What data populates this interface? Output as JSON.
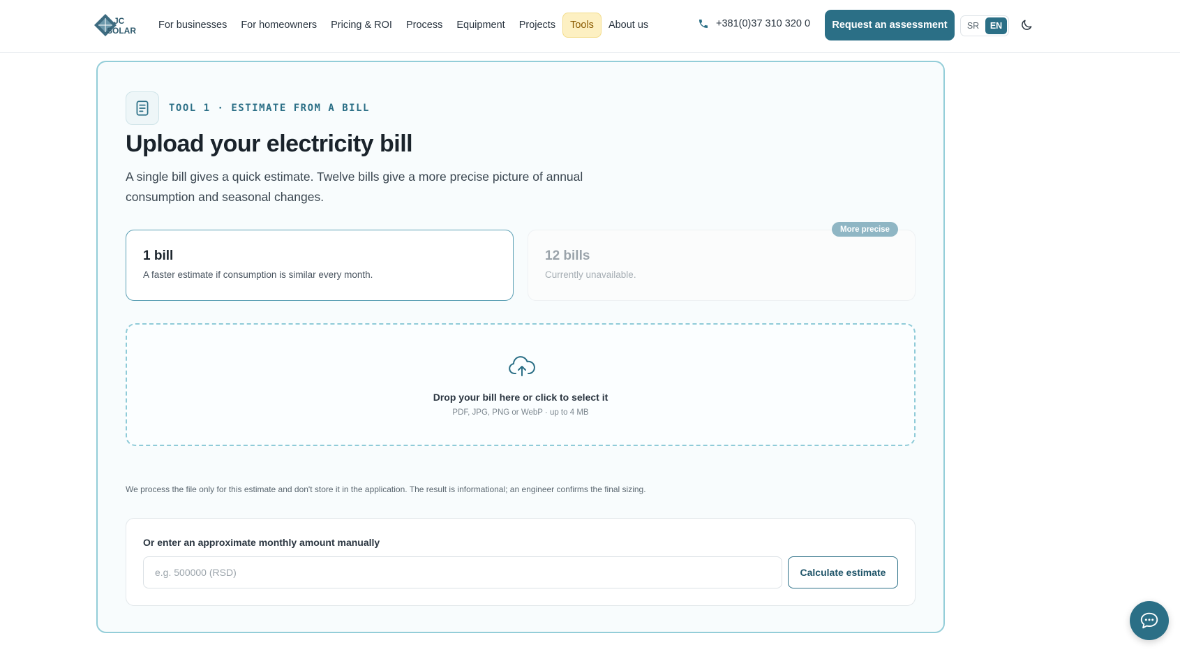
{
  "header": {
    "logo_text": "JC SOLAR",
    "nav": [
      {
        "label": "For businesses",
        "active": false
      },
      {
        "label": "For homeowners",
        "active": false
      },
      {
        "label": "Pricing & ROI",
        "active": false
      },
      {
        "label": "Process",
        "active": false
      },
      {
        "label": "Equipment",
        "active": false
      },
      {
        "label": "Projects",
        "active": false
      },
      {
        "label": "Tools",
        "active": true
      },
      {
        "label": "About us",
        "active": false
      }
    ],
    "phone": "+381(0)37 310 320 0",
    "phone_icon": "phone-icon",
    "cta_label": "Request an assessment",
    "lang": {
      "options": [
        "SR",
        "EN"
      ],
      "selected": "EN"
    },
    "theme_icon": "moon-icon"
  },
  "tool": {
    "icon": "document-icon",
    "label": "TOOL 1 · ESTIMATE FROM A BILL",
    "title": "Upload your electricity bill",
    "lead": "A single bill gives a quick estimate. Twelve bills give a more precise picture of annual consumption and seasonal changes.",
    "options": [
      {
        "title": "1 bill",
        "desc": "A faster estimate if consumption is similar every month.",
        "selected": true
      },
      {
        "title": "12 bills",
        "desc": "Currently unavailable.",
        "selected": false,
        "badge": "More precise"
      }
    ],
    "dropzone": {
      "icon": "cloud-upload-icon",
      "title": "Drop your bill here or click to select it",
      "sub": "PDF, JPG, PNG or WebP · up to 4 MB"
    },
    "note": "We process the file only for this estimate and don't store it in the application. The result is informational; an engineer confirms the final sizing.",
    "manual": {
      "label": "Or enter an approximate monthly amount manually",
      "placeholder": "e.g. 500000 (RSD)",
      "value": "",
      "button": "Calculate estimate"
    }
  },
  "chat_icon": "chat-icon",
  "colors": {
    "accent": "#2b6f86",
    "card_border": "#93cdd8",
    "active_nav_bg": "#fdf0c2"
  }
}
